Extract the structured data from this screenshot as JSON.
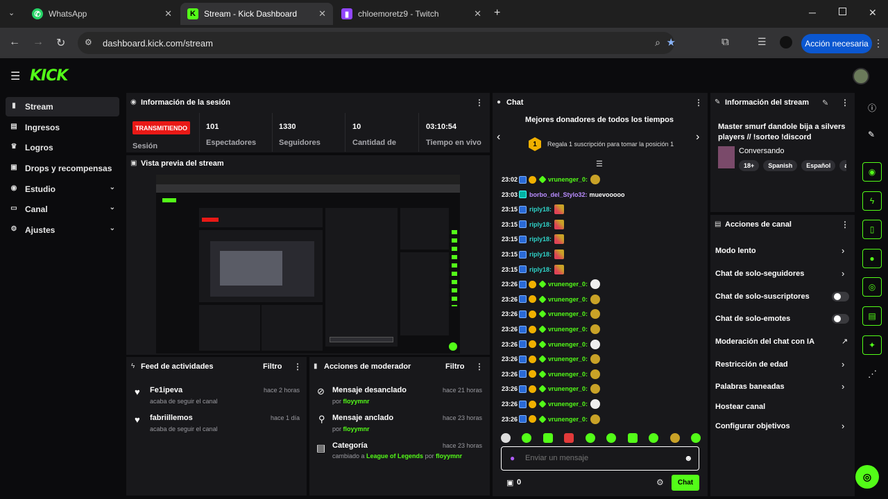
{
  "browser": {
    "tabs": [
      {
        "title": "WhatsApp"
      },
      {
        "title": "Stream - Kick Dashboard"
      },
      {
        "title": "chloemoretz9 - Twitch"
      }
    ],
    "url": "dashboard.kick.com/stream",
    "action_button": "Acción necesaria"
  },
  "kick": {
    "logo": "KICK"
  },
  "sidebar": {
    "items": [
      {
        "label": "Stream",
        "icon": "stream-icon"
      },
      {
        "label": "Ingresos",
        "icon": "income-icon"
      },
      {
        "label": "Logros",
        "icon": "trophy-icon"
      },
      {
        "label": "Drops y recompensas",
        "icon": "gift-icon"
      },
      {
        "label": "Estudio",
        "icon": "studio-icon"
      },
      {
        "label": "Canal",
        "icon": "channel-icon"
      },
      {
        "label": "Ajustes",
        "icon": "gear-icon"
      }
    ]
  },
  "session": {
    "title": "Información de la sesión",
    "status": "TRANSMITIENDO",
    "status_label": "Sesión",
    "stats": [
      {
        "value": "101",
        "label": "Espectadores"
      },
      {
        "value": "1330",
        "label": "Seguidores"
      },
      {
        "value": "10",
        "label": "Cantidad de"
      },
      {
        "value": "03:10:54",
        "label": "Tiempo en vivo"
      }
    ]
  },
  "preview": {
    "title": "Vista previa del stream"
  },
  "activity": {
    "title": "Feed de actividades",
    "filter": "Filtro",
    "items": [
      {
        "name": "Fe1ipeva",
        "sub": "acaba de seguir el canal",
        "time": "hace 2 horas"
      },
      {
        "name": "fabriillemos",
        "sub": "acaba de seguir el canal",
        "time": "hace 1 día"
      }
    ]
  },
  "modactions": {
    "title": "Acciones de moderador",
    "filter": "Filtro",
    "items": [
      {
        "title": "Mensaje desanclado",
        "by": "por",
        "user": "floyymnr",
        "time": "hace 21 horas"
      },
      {
        "title": "Mensaje anclado",
        "by": "por",
        "user": "floyymnr",
        "time": "hace 23 horas"
      },
      {
        "title": "Categoría",
        "by": "cambiado a",
        "game": "League of Legends",
        "by2": "por",
        "user": "floyymnr",
        "time": "hace 23 horas"
      }
    ]
  },
  "chat": {
    "title": "Chat",
    "donors_title": "Mejores donadores de todos los tiempos",
    "donors_rank": "1",
    "donors_text": "Regala 1 suscripción para tomar la posición 1",
    "messages": [
      {
        "time": "23:02",
        "user": "vrunenger_0:",
        "text": ""
      },
      {
        "time": "23:03",
        "user": "borbo_del_Stylo32:",
        "text": "muevooooo"
      },
      {
        "time": "23:15",
        "user": "riply18:",
        "text": ""
      },
      {
        "time": "23:15",
        "user": "riply18:",
        "text": ""
      },
      {
        "time": "23:15",
        "user": "riply18:",
        "text": ""
      },
      {
        "time": "23:15",
        "user": "riply18:",
        "text": ""
      },
      {
        "time": "23:15",
        "user": "riply18:",
        "text": ""
      },
      {
        "time": "23:26",
        "user": "vrunenger_0:",
        "text": ""
      },
      {
        "time": "23:26",
        "user": "vrunenger_0:",
        "text": ""
      },
      {
        "time": "23:26",
        "user": "vrunenger_0:",
        "text": ""
      },
      {
        "time": "23:26",
        "user": "vrunenger_0:",
        "text": ""
      },
      {
        "time": "23:26",
        "user": "vrunenger_0:",
        "text": ""
      },
      {
        "time": "23:26",
        "user": "vrunenger_0:",
        "text": ""
      },
      {
        "time": "23:26",
        "user": "vrunenger_0:",
        "text": ""
      },
      {
        "time": "23:26",
        "user": "vrunenger_0:",
        "text": ""
      },
      {
        "time": "23:26",
        "user": "vrunenger_0:",
        "text": ""
      },
      {
        "time": "23:26",
        "user": "vrunenger_0:",
        "text": ""
      }
    ],
    "input_placeholder": "Enviar un mensaje",
    "points": "0",
    "send_label": "Chat"
  },
  "streaminfo": {
    "title": "Información del stream",
    "stream_title": "Master smurf dandole bija a silvers players // !sorteo !discord",
    "category": "Conversando",
    "tags": [
      "18+",
      "Spanish",
      "Español",
      "argen"
    ]
  },
  "channelactions": {
    "title": "Acciones de canal",
    "items": [
      {
        "label": "Modo lento",
        "control": "chevron"
      },
      {
        "label": "Chat de solo-seguidores",
        "control": "chevron"
      },
      {
        "label": "Chat de solo-suscriptores",
        "control": "toggle"
      },
      {
        "label": "Chat de solo-emotes",
        "control": "toggle"
      },
      {
        "label": "Moderación del chat con IA",
        "control": "external"
      },
      {
        "label": "Restricción de edad",
        "control": "chevron"
      },
      {
        "label": "Palabras baneadas",
        "control": "chevron"
      },
      {
        "label": "Hostear canal",
        "control": "none"
      },
      {
        "label": "Configurar objetivos",
        "control": "chevron"
      }
    ]
  },
  "colors": {
    "accent": "#53fc18",
    "live": "#e91916",
    "panel": "#18181b",
    "bg": "#0b0b0d"
  }
}
